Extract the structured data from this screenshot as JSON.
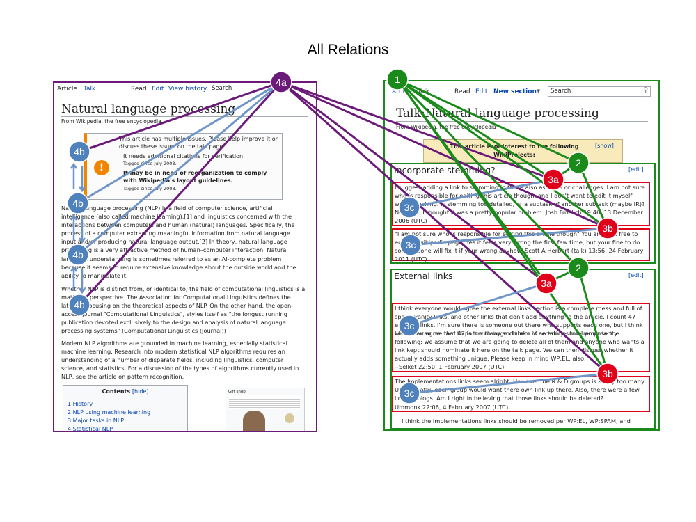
{
  "title": "All Relations",
  "article": {
    "tabs": [
      "Article",
      "Talk",
      "Read",
      "Edit",
      "View history"
    ],
    "search_placeholder": "Search",
    "heading": "Natural language processing",
    "subtitle": "From Wikipedia, the free encyclopedia",
    "issues_line1": "This article has multiple issues. Please help improve it or discuss these issues on the talk page.",
    "issues_item1": "It needs additional citations for verification.",
    "issues_item1_tag": "Tagged since July 2008.",
    "issues_item2": "It may be in need of reorganization to comply with Wikipedia's layout guidelines.",
    "issues_item2_tag": "Tagged since July 2008.",
    "para1": "Natural language processing (NLP) is a field of computer science, artificial intelligence (also called machine learning),[1] and linguistics concerned with the interactions between computers and human (natural) languages. Specifically, the process of a computer extracting meaningful information from natural language input and/or producing natural language output.[2] In theory, natural language processing is a very attractive method of human–computer interaction. Natural language understanding is sometimes referred to as an AI-complete problem because it seems to require extensive knowledge about the outside world and the ability to manipulate it.",
    "para2": "Whether NLP is distinct from, or identical to, the field of computational linguistics is a matter of perspective. The Association for Computational Linguistics defines the latter as focusing on the theoretical aspects of NLP. On the other hand, the open-access journal \"Computational Linguistics\", styles itself as \"the longest running publication devoted exclusively to the design and analysis of natural language processing systems\" (Computational Linguistics (Journal))",
    "para3": "Modern NLP algorithms are grounded in machine learning, especially statistical machine learning. Research into modern statistical NLP algorithms requires an understanding of a number of disparate fields, including linguistics, computer science, and statistics. For a discussion of the types of algorithms currently used in NLP, see the article on pattern recognition.",
    "toc_title": "Contents",
    "toc_hide": "[hide]",
    "toc_items": [
      "1 History",
      "2 NLP using machine learning",
      "3 Major tasks in NLP",
      "4 Statistical NLP"
    ],
    "thumb_caption": "Gift shop"
  },
  "talk": {
    "tabs": [
      "Article",
      "Talk",
      "Read",
      "Edit",
      "New section"
    ],
    "search_placeholder": "Search",
    "heading": "Talk:Natural language processing",
    "subtitle": "From Wikipedia, the free encyclopedia",
    "banner": "This article is of interest to the following WikiProjects:",
    "banner_show": "[show]",
    "section1_title": "Incorporate stemming?",
    "section1_edit": "[edit]",
    "comment1": "I suggest adding a link to stemming in these also as tasks or challenges. I am not sure who is responsible for editing this article though, and I don't want to edit it myself without asking. Is stemming too detailed, or a subtask of another subtask (maybe IR)? Not sure, I thought it was a pretty popular problem. Josh Froelich 19:46, 13 December 2006 (UTC)",
    "comment2": "\"I am not sure who is responsible for editing this article though\" You are, feel free to edit the wikipedia page. Yes it feels very wrong the first few time, but your fine to do so, someone will fix it if your wrong anyhow. Scott A Herbert (talk) 13:56, 24 February 2011 (UTC)",
    "section2_title": "External links",
    "section2_edit": "[edit]",
    "comment3a": "I think everyone would agree the external links section is a complete mess and full of spam, vanity links, and other links that don't add anything to the article. I count 47 external links. I'm sure there is someone out there who supports each one, but I think we all can agree that 47 is too many and there is certainly some redundancy.",
    "comment3b": "I know it can be hard to part with large chunks of an article, but I propose the following: we assume that we are going to delete all of them and anyone who wants a link kept should nominate it here on the talk page. We can then discuss whether it actually adds something unique. Please keep in mind WP:EL, also.",
    "comment3_sig": "--Selket 22:50, 1 February 2007 (UTC)",
    "comment4": "The Implementations links seem alright. However the R & D groups is a way too many. Unfortunatly, each group would want there own link up there. Also, there were a few links to blogs. Am I right in believing that those links should be deleted?",
    "comment4_sig": "Ummonk 22:06, 4 February 2007 (UTC)",
    "comment5": "I think the Implementations links should be removed per WP:EL, WP:SPAM, and"
  },
  "nodes": {
    "n1": "1",
    "n2": "2",
    "n3a": "3a",
    "n3b": "3b",
    "n3c": "3c",
    "n4a": "4a",
    "n4b": "4b"
  },
  "colors": {
    "purple": "#6b1a79",
    "green": "#1a8a1a",
    "red": "#e0001a",
    "blue_node": "#4f81bd",
    "blue_line": "#6f95c8"
  }
}
